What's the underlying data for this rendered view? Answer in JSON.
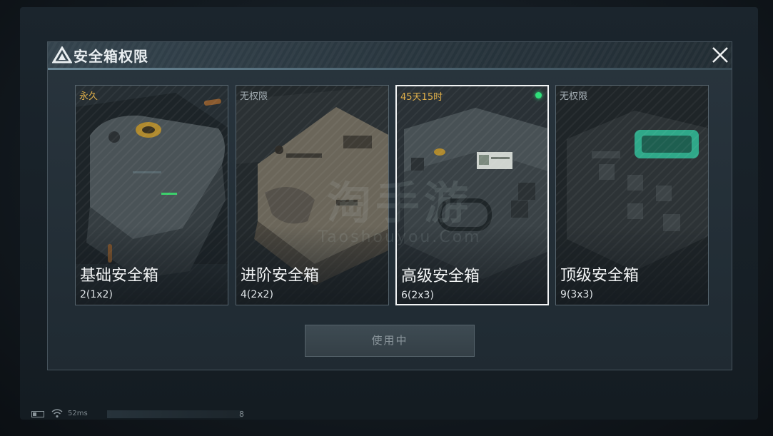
{
  "dialog": {
    "title": "安全箱权限",
    "use_button_label": "使用中"
  },
  "cards": [
    {
      "tag": "永久",
      "name": "基础安全箱",
      "capacity": "2(1x2)",
      "selected": false,
      "active_dot": false,
      "tag_color": "#e0b04a"
    },
    {
      "tag": "无权限",
      "name": "进阶安全箱",
      "capacity": "4(2x2)",
      "selected": false,
      "active_dot": false,
      "tag_color": "#a6b0b6"
    },
    {
      "tag": "45天15时",
      "name": "高级安全箱",
      "capacity": "6(2x3)",
      "selected": true,
      "active_dot": true,
      "tag_color": "#e0b04a"
    },
    {
      "tag": "无权限",
      "name": "顶级安全箱",
      "capacity": "9(3x3)",
      "selected": false,
      "active_dot": false,
      "tag_color": "#a6b0b6"
    }
  ],
  "watermark": {
    "cn": "淘手游",
    "en": "Taoshouyou.Com"
  },
  "status_bar": {
    "ping": "52ms",
    "counter": "8"
  },
  "colors": {
    "accent_gold": "#e0b04a",
    "active_green": "#2fe07a",
    "selected_border": "#f2f4f5"
  },
  "icons": [
    "brand-triangle-icon",
    "close-icon",
    "battery-icon",
    "wifi-icon",
    "active-dot-icon"
  ]
}
